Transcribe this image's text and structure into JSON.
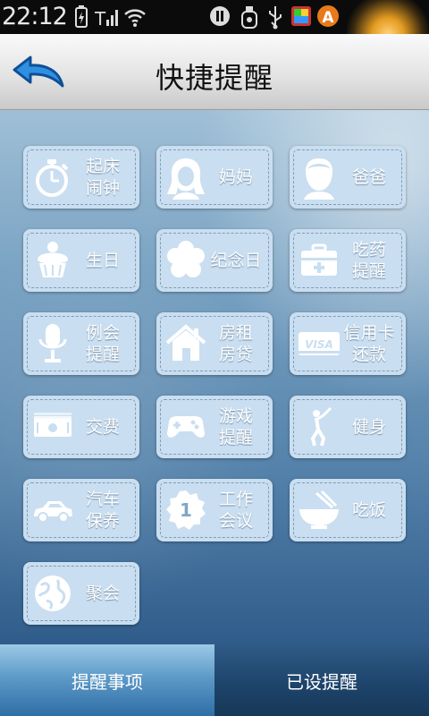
{
  "status_bar": {
    "time": "22:12"
  },
  "header": {
    "title": "快捷提醒",
    "back_icon": "back-arrow-icon"
  },
  "tiles": [
    {
      "id": "alarm",
      "label": "起床\n闹钟",
      "icon": "stopwatch-icon"
    },
    {
      "id": "mom",
      "label": "妈妈",
      "icon": "woman-icon"
    },
    {
      "id": "dad",
      "label": "爸爸",
      "icon": "man-icon"
    },
    {
      "id": "birthday",
      "label": "生日",
      "icon": "cake-icon"
    },
    {
      "id": "anniversary",
      "label": "纪念日",
      "icon": "flower-icon"
    },
    {
      "id": "medicine",
      "label": "吃药\n提醒",
      "icon": "medkit-icon"
    },
    {
      "id": "meeting",
      "label": "例会\n提醒",
      "icon": "microphone-icon"
    },
    {
      "id": "rent",
      "label": "房租\n房贷",
      "icon": "house-icon"
    },
    {
      "id": "credit",
      "label": "信用卡\n还款",
      "icon": "credit-card-icon"
    },
    {
      "id": "bills",
      "label": "交费",
      "icon": "money-icon"
    },
    {
      "id": "game",
      "label": "游戏\n提醒",
      "icon": "gamepad-icon"
    },
    {
      "id": "fitness",
      "label": "健身",
      "icon": "golfer-icon"
    },
    {
      "id": "car",
      "label": "汽车\n保养",
      "icon": "car-icon"
    },
    {
      "id": "work",
      "label": "工作\n会议",
      "icon": "badge-one-icon"
    },
    {
      "id": "eat",
      "label": "吃饭",
      "icon": "bowl-icon"
    },
    {
      "id": "party",
      "label": "聚会",
      "icon": "globe-icon"
    }
  ],
  "tile_icon_texts": {
    "credit_card": "VISA",
    "badge": "1"
  },
  "tabs": [
    {
      "label": "提醒事项",
      "active": true
    },
    {
      "label": "已设提醒",
      "active": false
    }
  ],
  "colors": {
    "tile": "#c9def0",
    "tab_active": "#5e9bc8",
    "tab_inactive": "#1f466e"
  }
}
